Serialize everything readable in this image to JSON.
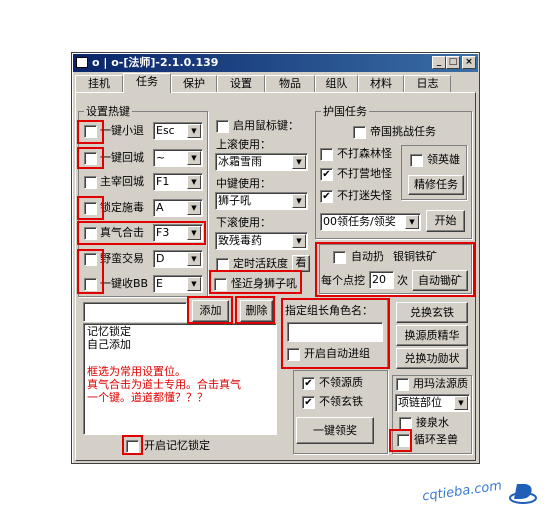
{
  "window": {
    "title": "o | o-[法师]-2.1.0.139",
    "min": "_",
    "max": "□",
    "close": "×"
  },
  "tabs": [
    "挂机",
    "任务",
    "保护",
    "设置",
    "物品",
    "组队",
    "材料",
    "日志"
  ],
  "hotkeys": {
    "group_title": "设置热键",
    "rows": [
      {
        "label": "一键小退",
        "value": "Esc",
        "checked": false
      },
      {
        "label": "一键回城",
        "value": "~",
        "checked": false
      },
      {
        "label": "主宰回城",
        "value": "F1",
        "checked": false
      },
      {
        "label": "锁定施毒",
        "value": "A",
        "checked": false
      },
      {
        "label": "真气合击",
        "value": "F3",
        "checked": false
      },
      {
        "label": "野蛮交易",
        "value": "D",
        "checked": false
      },
      {
        "label": "一键收BB",
        "value": "E",
        "checked": false
      }
    ]
  },
  "mouse": {
    "enable_label": "启用鼠标键：",
    "scroll_up_label": "上滚使用：",
    "scroll_up_value": "冰霜雪雨",
    "middle_label": "中键使用：",
    "middle_value": "狮子吼",
    "scroll_down_label": "下滚使用：",
    "scroll_down_value": "致残毒药",
    "timing_label": "定时活跃度",
    "timing_btn": "看",
    "near_lion_label": "怪近身狮子吼"
  },
  "guard": {
    "group_title": "护国任务",
    "emperor": "帝国挑战任务",
    "no_forest": {
      "label": "不打森林怪",
      "checked": false
    },
    "no_camp": {
      "label": "不打营地怪",
      "checked": true
    },
    "no_maze": {
      "label": "不打迷失怪",
      "checked": true
    },
    "hero": {
      "label": "领英雄",
      "checked": false
    },
    "repair_btn": "精修任务",
    "select_value": "00领任务/领奖",
    "start_btn": "开始"
  },
  "mining": {
    "auto_throw": "自动扔",
    "ore": "银铜铁矿",
    "every": "每个点挖",
    "count": "20",
    "times": "次",
    "auto_btn": "自动锄矿"
  },
  "list_controls": {
    "input_value": "",
    "add_btn": "添加",
    "delete_btn": "删除"
  },
  "memo": {
    "lines": [
      "记忆锁定",
      "自己添加"
    ],
    "red_lines": [
      "框选为常用设置位。",
      "真气合击为道士专用。合击真气",
      "一个键。道道都懂？？？"
    ]
  },
  "bottom_checkbox": "开启记忆锁定",
  "leader": {
    "title": "指定组长角色名：",
    "input_value": "",
    "auto_team": "开启自动进组"
  },
  "resources": {
    "no_source": {
      "label": "不领源质",
      "checked": true
    },
    "no_iron": {
      "label": "不领玄铁",
      "checked": true
    },
    "one_key_btn": "一键领奖",
    "exchange_iron": "兑换玄铁",
    "exchange_essence": "换源质精华",
    "exchange_merit": "兑换功勋状",
    "use_stone": {
      "label": "用玛法源质",
      "checked": false
    },
    "part_value": "项链部位",
    "spring": {
      "label": "接泉水",
      "checked": false
    },
    "beast": {
      "label": "循环圣兽",
      "checked": false
    }
  },
  "watermark": {
    "text": "cqtieba.com"
  }
}
